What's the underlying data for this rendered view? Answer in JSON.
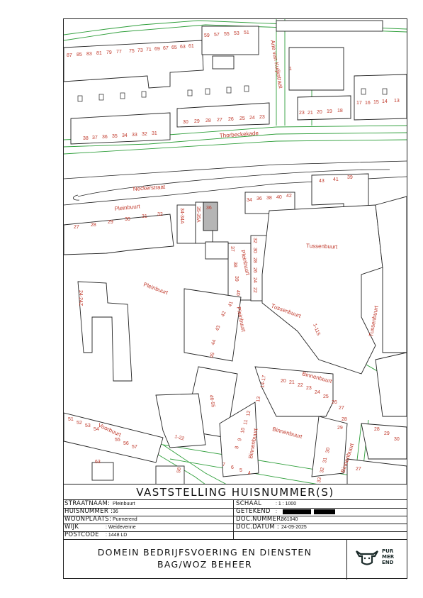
{
  "map": {
    "house_numbers": {
      "top_left_row": [
        "87",
        "85",
        "83",
        "81",
        "79",
        "77",
        "75",
        "73",
        "71",
        "69",
        "67",
        "65",
        "63",
        "61",
        "59",
        "57",
        "55",
        "53",
        "51"
      ],
      "top_right_row": [
        "23",
        "21",
        "20",
        "19",
        "18",
        "17",
        "16",
        "15",
        "14",
        "13"
      ],
      "thorbecke_row": [
        "38",
        "37",
        "36",
        "35",
        "34",
        "33",
        "32",
        "31",
        "30",
        "29",
        "28",
        "27",
        "26",
        "25",
        "24",
        "23"
      ],
      "pleinbuurt_row": [
        "27",
        "28",
        "29",
        "30",
        "31",
        "32"
      ],
      "pleinbuurt_center": [
        "34-34A",
        "35-35A",
        "36"
      ],
      "neckerstraat_row": [
        "34",
        "36",
        "38",
        "40",
        "42",
        "43",
        "41",
        "39"
      ],
      "pleinbuurt_vertical": [
        "37",
        "38",
        "39",
        "40"
      ],
      "tussenbuurt_vertical": [
        "32",
        "30",
        "28",
        "26",
        "24",
        "22"
      ],
      "pleinbuurt_cluster": [
        "41",
        "42",
        "43",
        "44",
        "45"
      ],
      "binnenbuurt_top": [
        "14-17",
        "13",
        "20",
        "21",
        "22",
        "23",
        "24",
        "25",
        "26",
        "27",
        "28",
        "29"
      ],
      "binnenbuurt_west": [
        "12",
        "11",
        "10",
        "9",
        "8",
        "7",
        "6",
        "5",
        "4"
      ],
      "binnenbuurt_east": [
        "30",
        "31",
        "32",
        "33"
      ],
      "voorbuurt_row": [
        "51",
        "52",
        "53",
        "54",
        "55",
        "56",
        "57",
        "63"
      ],
      "far_right_block": [
        "28",
        "29",
        "30",
        "27"
      ],
      "misc": [
        "1",
        "24-24Z",
        "1-115",
        "46-55",
        "1-22",
        "58"
      ]
    },
    "street_labels": {
      "arie": "Arie van Kuijkstraat",
      "thorbecke": "Thorbeckekade",
      "necker": "Neckerstraat",
      "plein1": "Pleinbuurt",
      "plein2": "Pleinbuurt",
      "plein3": "Pleinbuurt",
      "plein4": "Pleinbuurt",
      "tussen1": "Tussenbuurt",
      "tussen2": "Tussenbuurt",
      "tussen3": "Tussenbuurt",
      "binnen1": "Binnenbuurt",
      "binnen2": "Binnenbuurt",
      "binnen3": "Binnenbuurt",
      "binnen4": "Binnenbuurt",
      "voor": "Voorbuurt"
    },
    "highlighted_parcel": "36",
    "colors": {
      "label": "#c0392b",
      "road": "#2e9e3a",
      "building": "#222222",
      "highlight": "#b5b5b5"
    }
  },
  "title_block": {
    "title": "VASTSTELLING HUISNUMMER(S)",
    "straatnaam_label": "STRAATNAAM:",
    "straatnaam_value": "Pleinbuurt",
    "huisnummer_label": "HUISNUMMER :",
    "huisnummer_value": "36",
    "woonplaats_label": "WOONPLAATS:",
    "woonplaats_value": "Purmerend",
    "wijk_label": "WIJK",
    "wijk_value": ": Weidevenne",
    "postcode_label": "POSTCODE",
    "postcode_value": ": 1448 LD",
    "schaal_label": "SCHAAL",
    "schaal_value": ": 1 : 1000",
    "getekend_label": "GETEKEND",
    "getekend_sep": ":",
    "docnummer_label": "DOC.NUMMER:",
    "docnummer_value": "861040",
    "docdatum_label": "DOC.DATUM :",
    "docdatum_value": "24-09-2025",
    "org_line1": "DOMEIN BEDRIJFSVOERING EN DIENSTEN",
    "org_line2": "BAG/WOZ BEHEER",
    "logo_line1": "PUR",
    "logo_line2": "MER",
    "logo_line3": "END"
  }
}
